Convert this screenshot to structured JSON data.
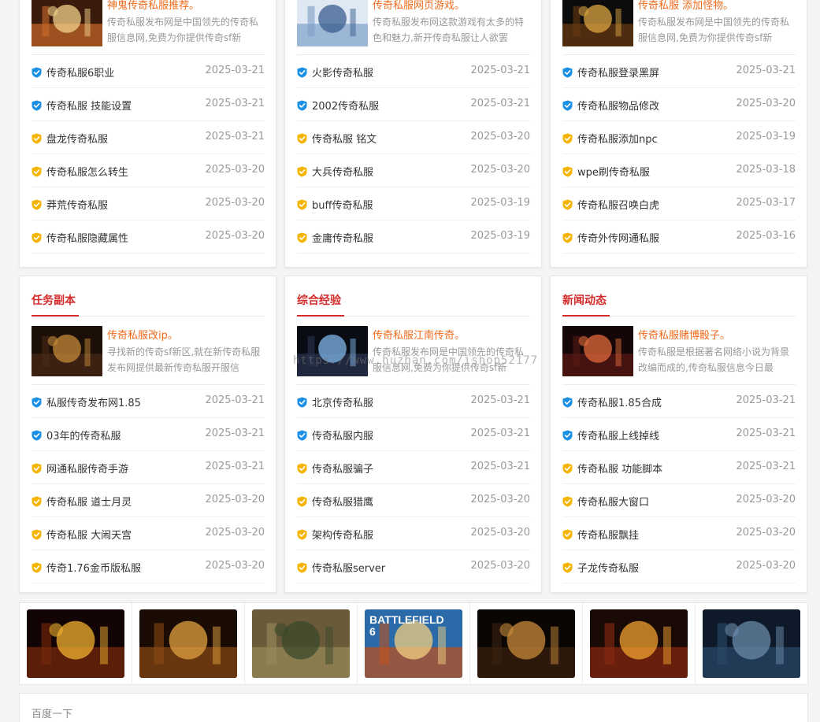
{
  "top_cards": [
    {
      "feature": {
        "title": "神鬼传奇私服推荐。",
        "desc": "传奇私服发布网是中国领先的传奇私服信息网,免费为你提供传奇sf新"
      },
      "rows": [
        {
          "label": "传奇私服6职业",
          "date": "2025-03-21",
          "badge": "blue"
        },
        {
          "label": "传奇私服 技能设置",
          "date": "2025-03-21",
          "badge": "blue"
        },
        {
          "label": "盘龙传奇私服",
          "date": "2025-03-21",
          "badge": "gold"
        },
        {
          "label": "传奇私服怎么转生",
          "date": "2025-03-20",
          "badge": "gold"
        },
        {
          "label": "莽荒传奇私服",
          "date": "2025-03-20",
          "badge": "gold"
        },
        {
          "label": "传奇私服隐藏属性",
          "date": "2025-03-20",
          "badge": "gold"
        }
      ]
    },
    {
      "feature": {
        "title": "传奇私服网页游戏。",
        "desc": "传奇私服发布网这款游戏有太多的特色和魅力,新开传奇私服让人欲罢"
      },
      "rows": [
        {
          "label": "火影传奇私服",
          "date": "2025-03-21",
          "badge": "blue"
        },
        {
          "label": "2002传奇私服",
          "date": "2025-03-21",
          "badge": "blue"
        },
        {
          "label": "传奇私服 铭文",
          "date": "2025-03-20",
          "badge": "gold"
        },
        {
          "label": "大兵传奇私服",
          "date": "2025-03-20",
          "badge": "gold"
        },
        {
          "label": "buff传奇私服",
          "date": "2025-03-19",
          "badge": "gold"
        },
        {
          "label": "金庸传奇私服",
          "date": "2025-03-19",
          "badge": "gold"
        }
      ]
    },
    {
      "feature": {
        "title": "传奇私服 添加怪物。",
        "desc": "传奇私服发布网是中国领先的传奇私服信息网,免费为你提供传奇sf新"
      },
      "rows": [
        {
          "label": "传奇私服登录黑屏",
          "date": "2025-03-21",
          "badge": "blue"
        },
        {
          "label": "传奇私服物品修改",
          "date": "2025-03-20",
          "badge": "blue"
        },
        {
          "label": "传奇私服添加npc",
          "date": "2025-03-19",
          "badge": "gold"
        },
        {
          "label": "wpe刷传奇私服",
          "date": "2025-03-18",
          "badge": "gold"
        },
        {
          "label": "传奇私服召唤白虎",
          "date": "2025-03-17",
          "badge": "gold"
        },
        {
          "label": "传奇外传网通私服",
          "date": "2025-03-16",
          "badge": "gold"
        }
      ]
    }
  ],
  "bottom_cards": [
    {
      "title": "任务副本",
      "feature": {
        "title": "传奇私服改ip。",
        "desc": "寻找新的传奇sf新区,就在新传奇私服发布网提供最新传奇私服开服信"
      },
      "rows": [
        {
          "label": "私服传奇发布网1.85",
          "date": "2025-03-21",
          "badge": "blue"
        },
        {
          "label": "03年的传奇私服",
          "date": "2025-03-21",
          "badge": "blue"
        },
        {
          "label": "网通私服传奇手游",
          "date": "2025-03-21",
          "badge": "gold"
        },
        {
          "label": "传奇私服 道士月灵",
          "date": "2025-03-20",
          "badge": "gold"
        },
        {
          "label": "传奇私服 大闹天宫",
          "date": "2025-03-20",
          "badge": "gold"
        },
        {
          "label": "传奇1.76金币版私服",
          "date": "2025-03-20",
          "badge": "gold"
        }
      ]
    },
    {
      "title": "综合经验",
      "feature": {
        "title": "传奇私服江南传奇。",
        "desc": "传奇私服发布网是中国领先的传奇私服信息网,免费为你提供传奇sf新"
      },
      "rows": [
        {
          "label": "北京传奇私服",
          "date": "2025-03-21",
          "badge": "blue"
        },
        {
          "label": "传奇私服内服",
          "date": "2025-03-21",
          "badge": "blue"
        },
        {
          "label": "传奇私服骗子",
          "date": "2025-03-21",
          "badge": "gold"
        },
        {
          "label": "传奇私服猎鹰",
          "date": "2025-03-20",
          "badge": "gold"
        },
        {
          "label": "架构传奇私服",
          "date": "2025-03-20",
          "badge": "gold"
        },
        {
          "label": "传奇私服server",
          "date": "2025-03-20",
          "badge": "gold"
        }
      ]
    },
    {
      "title": "新闻动态",
      "feature": {
        "title": "传奇私服赌博骰子。",
        "desc": "传奇私服是根据著名网络小说为背景改编而成的,传奇私服信息今日最"
      },
      "rows": [
        {
          "label": "传奇私服1.85合成",
          "date": "2025-03-21",
          "badge": "blue"
        },
        {
          "label": "传奇私服上线掉线",
          "date": "2025-03-21",
          "badge": "blue"
        },
        {
          "label": "传奇私服 功能脚本",
          "date": "2025-03-21",
          "badge": "gold"
        },
        {
          "label": "传奇私服大窗口",
          "date": "2025-03-20",
          "badge": "gold"
        },
        {
          "label": "传奇私服飘挂",
          "date": "2025-03-20",
          "badge": "gold"
        },
        {
          "label": "子龙传奇私服",
          "date": "2025-03-20",
          "badge": "gold"
        }
      ]
    }
  ],
  "strip_images": [
    {
      "name": "game-banner-1",
      "caption": ""
    },
    {
      "name": "game-banner-2",
      "caption": ""
    },
    {
      "name": "game-banner-3",
      "caption": ""
    },
    {
      "name": "game-banner-4",
      "caption": "BATTLEFIELD 6"
    },
    {
      "name": "game-banner-5",
      "caption": ""
    },
    {
      "name": "game-banner-6",
      "caption": ""
    },
    {
      "name": "game-banner-7",
      "caption": ""
    }
  ],
  "footer_link": "百度一下",
  "watermark": "https://www.huzhan.com/ishop52177",
  "colors": {
    "accent_red": "#d42a2a",
    "feature_orange": "#f06a1b",
    "badge_blue": "#1a8fe3",
    "badge_gold": "#f5b400"
  }
}
